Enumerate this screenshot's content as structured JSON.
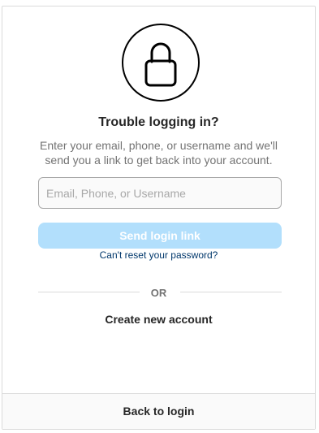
{
  "header": {
    "icon": "lock-icon",
    "title": "Trouble logging in?",
    "description": "Enter your email, phone, or username and we'll send you a link to get back into your account."
  },
  "form": {
    "input_placeholder": "Email, Phone, or Username",
    "input_value": "",
    "send_label": "Send login link",
    "reset_link": "Can't reset your password?"
  },
  "divider": {
    "label": "OR"
  },
  "create_account": "Create new account",
  "footer": {
    "back_label": "Back to login"
  },
  "colors": {
    "button_disabled": "#b2dffc",
    "link": "#00376b",
    "text_primary": "#262626",
    "text_secondary": "#737373",
    "border": "#dbdbdb"
  }
}
